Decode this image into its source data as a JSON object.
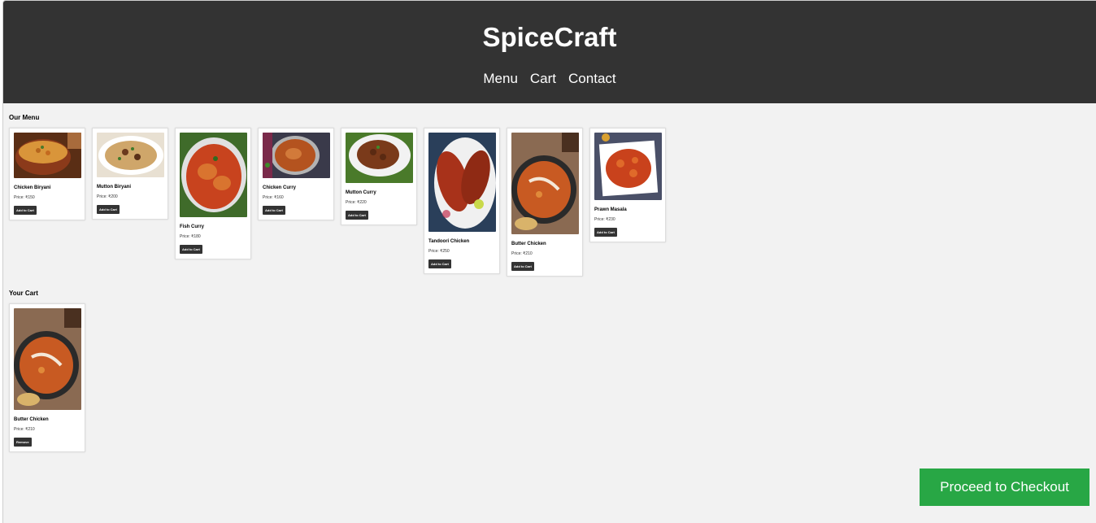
{
  "site": {
    "title": "SpiceCraft"
  },
  "nav": [
    "Menu",
    "Cart",
    "Contact"
  ],
  "menu": {
    "title": "Our Menu",
    "button_label": "Add to Cart",
    "items": [
      {
        "name": "Chicken Biryani",
        "price": "Price: ₹150",
        "image": "biryani-bowl"
      },
      {
        "name": "Mutton Biryani",
        "price": "Price: ₹200",
        "image": "biryani-plate"
      },
      {
        "name": "Fish Curry",
        "price": "Price: ₹180",
        "image": "fish-curry"
      },
      {
        "name": "Chicken Curry",
        "price": "Price: ₹160",
        "image": "chicken-curry"
      },
      {
        "name": "Mutton Curry",
        "price": "Price: ₹220",
        "image": "mutton-curry"
      },
      {
        "name": "Tandoori Chicken",
        "price": "Price: ₹250",
        "image": "tandoori-chicken"
      },
      {
        "name": "Butter Chicken",
        "price": "Price: ₹210",
        "image": "butter-chicken"
      },
      {
        "name": "Prawn Masala",
        "price": "Price: ₹230",
        "image": "prawn-masala"
      }
    ]
  },
  "cart": {
    "title": "Your Cart",
    "button_label": "Remove",
    "items": [
      {
        "name": "Butter Chicken",
        "price": "Price: ₹210",
        "image": "butter-chicken"
      }
    ]
  },
  "checkout": {
    "label": "Proceed to Checkout"
  },
  "colors": {
    "header": "#333333",
    "accent": "#28a745",
    "background": "#f2f2f2"
  }
}
